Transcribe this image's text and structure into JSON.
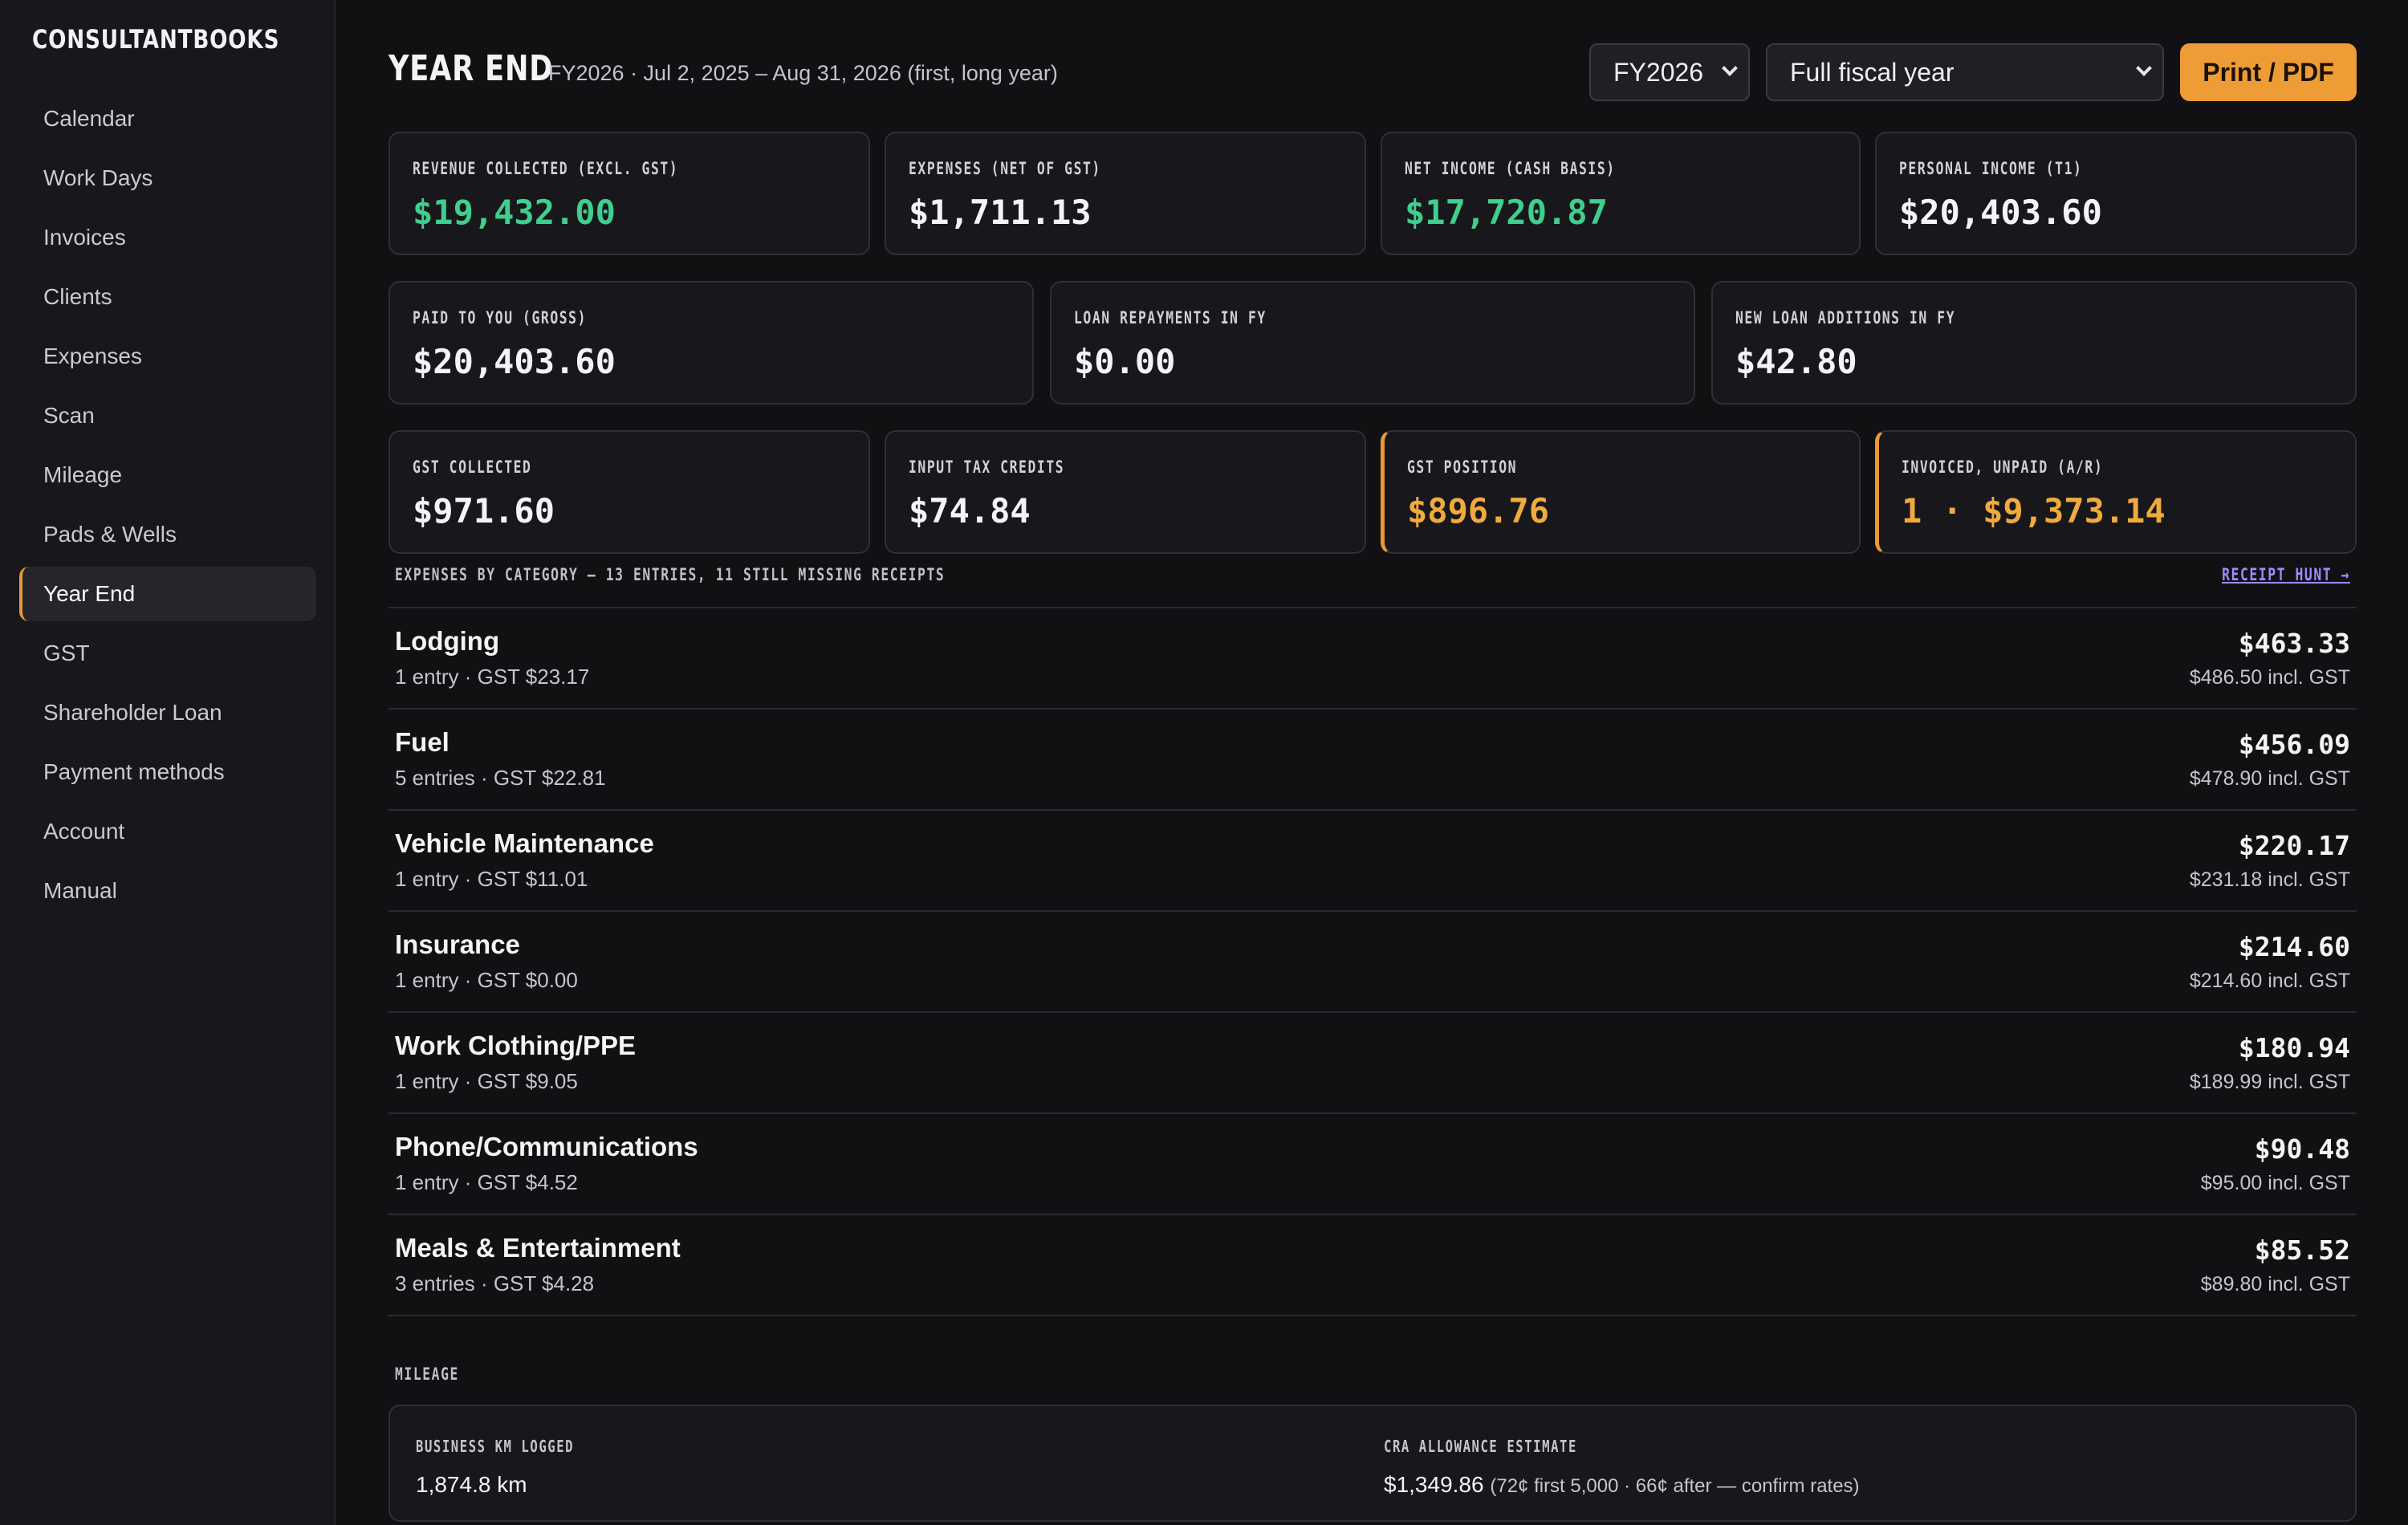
{
  "app": {
    "brand": "CONSULTANTBOOKS"
  },
  "sidebar": {
    "items": [
      {
        "label": "Calendar",
        "active": false
      },
      {
        "label": "Work Days",
        "active": false
      },
      {
        "label": "Invoices",
        "active": false
      },
      {
        "label": "Clients",
        "active": false
      },
      {
        "label": "Expenses",
        "active": false
      },
      {
        "label": "Scan",
        "active": false
      },
      {
        "label": "Mileage",
        "active": false
      },
      {
        "label": "Pads & Wells",
        "active": false
      },
      {
        "label": "Year End",
        "active": true
      },
      {
        "label": "GST",
        "active": false
      },
      {
        "label": "Shareholder Loan",
        "active": false
      },
      {
        "label": "Payment methods",
        "active": false
      },
      {
        "label": "Account",
        "active": false
      },
      {
        "label": "Manual",
        "active": false
      }
    ]
  },
  "header": {
    "title": "YEAR END",
    "subtitle": "FY2026 · Jul 2, 2025 – Aug 31, 2026 (first, long year)",
    "fiscal_year_select": "FY2026",
    "period_select": "Full fiscal year",
    "print_button": "Print / PDF"
  },
  "cards": {
    "revenue": {
      "label": "REVENUE COLLECTED (EXCL. GST)",
      "value": "$19,432.00"
    },
    "expenses": {
      "label": "EXPENSES (NET OF GST)",
      "value": "$1,711.13"
    },
    "net_income": {
      "label": "NET INCOME (CASH BASIS)",
      "value": "$17,720.87"
    },
    "personal_income": {
      "label": "PERSONAL INCOME (T1)",
      "value": "$20,403.60"
    },
    "paid_to_you": {
      "label": "PAID TO YOU (GROSS)",
      "value": "$20,403.60"
    },
    "loan_repayments": {
      "label": "LOAN REPAYMENTS IN FY",
      "value": "$0.00"
    },
    "new_loan_additions": {
      "label": "NEW LOAN ADDITIONS IN FY",
      "value": "$42.80"
    },
    "gst_collected": {
      "label": "GST COLLECTED",
      "value": "$971.60"
    },
    "input_tax_credits": {
      "label": "INPUT TAX CREDITS",
      "value": "$74.84"
    },
    "gst_position": {
      "label": "GST POSITION",
      "value": "$896.76"
    },
    "invoiced_unpaid": {
      "label": "INVOICED, UNPAID (A/R)",
      "value": "1 · $9,373.14"
    }
  },
  "expenses_section": {
    "title": "EXPENSES BY CATEGORY — 13 ENTRIES, 11 STILL MISSING RECEIPTS",
    "link": "RECEIPT HUNT →",
    "rows": [
      {
        "name": "Lodging",
        "meta": "1 entry · GST $23.17",
        "amount": "$463.33",
        "incl": "$486.50 incl. GST"
      },
      {
        "name": "Fuel",
        "meta": "5 entries · GST $22.81",
        "amount": "$456.09",
        "incl": "$478.90 incl. GST"
      },
      {
        "name": "Vehicle Maintenance",
        "meta": "1 entry · GST $11.01",
        "amount": "$220.17",
        "incl": "$231.18 incl. GST"
      },
      {
        "name": "Insurance",
        "meta": "1 entry · GST $0.00",
        "amount": "$214.60",
        "incl": "$214.60 incl. GST"
      },
      {
        "name": "Work Clothing/PPE",
        "meta": "1 entry · GST $9.05",
        "amount": "$180.94",
        "incl": "$189.99 incl. GST"
      },
      {
        "name": "Phone/Communications",
        "meta": "1 entry · GST $4.52",
        "amount": "$90.48",
        "incl": "$95.00 incl. GST"
      },
      {
        "name": "Meals & Entertainment",
        "meta": "3 entries · GST $4.28",
        "amount": "$85.52",
        "incl": "$89.80 incl. GST"
      }
    ]
  },
  "mileage": {
    "title": "MILEAGE",
    "business_km_label": "BUSINESS KM LOGGED",
    "business_km_value": "1,874.8 km",
    "allowance_label": "CRA ALLOWANCE ESTIMATE",
    "allowance_value": "$1,349.86",
    "allowance_note": "(72¢ first 5,000 · 66¢ after — confirm rates)"
  },
  "colors": {
    "accent": "#ed9c36",
    "positive": "#3fcf8e",
    "warning": "#f0aa3e",
    "link": "#9b8cff"
  }
}
